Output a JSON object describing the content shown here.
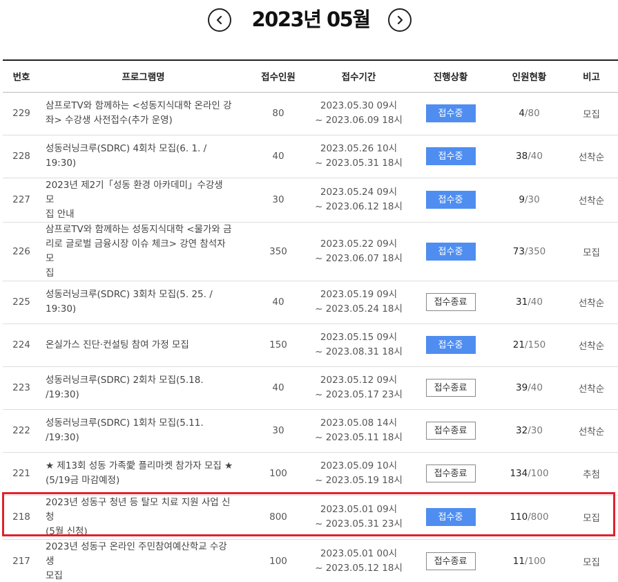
{
  "header": {
    "month_title": "2023년 05월",
    "prev_icon": "chevron-left-icon",
    "next_icon": "chevron-right-icon"
  },
  "table": {
    "columns": [
      "번호",
      "프로그램명",
      "접수인원",
      "접수기간",
      "진행상황",
      "인원현황",
      "비고"
    ],
    "rows": [
      {
        "no": "229",
        "title_lines": [
          "삼프로TV와 함께하는 <성동지식대학 온라인 강",
          "좌> 수강생 사전접수(추가 운영)"
        ],
        "capacity": "80",
        "period_start": "2023.05.30 09시",
        "period_end": "~ 2023.06.09 18시",
        "status": "접수중",
        "status_type": "open",
        "current": "4",
        "total": "80",
        "note": "모집"
      },
      {
        "no": "228",
        "title_lines": [
          "성동러닝크루(SDRC) 4회차 모집(6. 1. / 19:30)"
        ],
        "capacity": "40",
        "period_start": "2023.05.26 10시",
        "period_end": "~ 2023.05.31 18시",
        "status": "접수중",
        "status_type": "open",
        "current": "38",
        "total": "40",
        "note": "선착순"
      },
      {
        "no": "227",
        "title_lines": [
          "2023년 제2기「성동 환경 아카데미」수강생 모",
          "집 안내"
        ],
        "capacity": "30",
        "period_start": "2023.05.24 09시",
        "period_end": "~ 2023.06.12 18시",
        "status": "접수중",
        "status_type": "open",
        "current": "9",
        "total": "30",
        "note": "선착순"
      },
      {
        "no": "226",
        "title_lines": [
          "삼프로TV와 함께하는 성동지식대학 <물가와 금",
          "리로 글로벌 금융시장 이슈 체크> 강연 참석자 모",
          "집"
        ],
        "capacity": "350",
        "period_start": "2023.05.22 09시",
        "period_end": "~ 2023.06.07 18시",
        "status": "접수중",
        "status_type": "open",
        "current": "73",
        "total": "350",
        "note": "모집"
      },
      {
        "no": "225",
        "title_lines": [
          "성동러닝크루(SDRC) 3회차 모집(5. 25. / 19:30)"
        ],
        "capacity": "40",
        "period_start": "2023.05.19 09시",
        "period_end": "~ 2023.05.24 18시",
        "status": "접수종료",
        "status_type": "closed",
        "current": "31",
        "total": "40",
        "note": "선착순"
      },
      {
        "no": "224",
        "title_lines": [
          "온실가스 진단·컨설팅 참여 가정 모집"
        ],
        "capacity": "150",
        "period_start": "2023.05.15 09시",
        "period_end": "~ 2023.08.31 18시",
        "status": "접수중",
        "status_type": "open",
        "current": "21",
        "total": "150",
        "note": "선착순"
      },
      {
        "no": "223",
        "title_lines": [
          "성동러닝크루(SDRC) 2회차 모집(5.18. /19:30)"
        ],
        "capacity": "40",
        "period_start": "2023.05.12 09시",
        "period_end": "~ 2023.05.17 23시",
        "status": "접수종료",
        "status_type": "closed",
        "current": "39",
        "total": "40",
        "note": "선착순"
      },
      {
        "no": "222",
        "title_lines": [
          "성동러닝크루(SDRC) 1회차 모집(5.11. /19:30)"
        ],
        "capacity": "30",
        "period_start": "2023.05.08 14시",
        "period_end": "~ 2023.05.11 18시",
        "status": "접수종료",
        "status_type": "closed",
        "current": "32",
        "total": "30",
        "note": "선착순"
      },
      {
        "no": "221",
        "title_lines": [
          "★ 제13회 성동 가족愛 플리마켓 참가자 모집 ★",
          "(5/19금 마감예정)"
        ],
        "capacity": "100",
        "period_start": "2023.05.09 10시",
        "period_end": "~ 2023.05.19 18시",
        "status": "접수종료",
        "status_type": "closed",
        "current": "134",
        "total": "100",
        "note": "추첨"
      },
      {
        "no": "218",
        "title_lines": [
          "2023년 성동구 청년 등 탈모 치료 지원 사업 신청",
          "(5월 신청)"
        ],
        "capacity": "800",
        "period_start": "2023.05.01 09시",
        "period_end": "~ 2023.05.31 23시",
        "status": "접수중",
        "status_type": "open",
        "current": "110",
        "total": "800",
        "note": "모집"
      },
      {
        "no": "217",
        "title_lines": [
          "2023년 성동구 온라인 주민참여예산학교 수강생",
          "모집"
        ],
        "capacity": "100",
        "period_start": "2023.05.01 00시",
        "period_end": "~ 2023.05.12 18시",
        "status": "접수종료",
        "status_type": "closed",
        "current": "11",
        "total": "100",
        "note": "모집"
      }
    ]
  },
  "colors": {
    "open_badge": "#4f8ef0",
    "highlight_border": "#e2202b"
  }
}
